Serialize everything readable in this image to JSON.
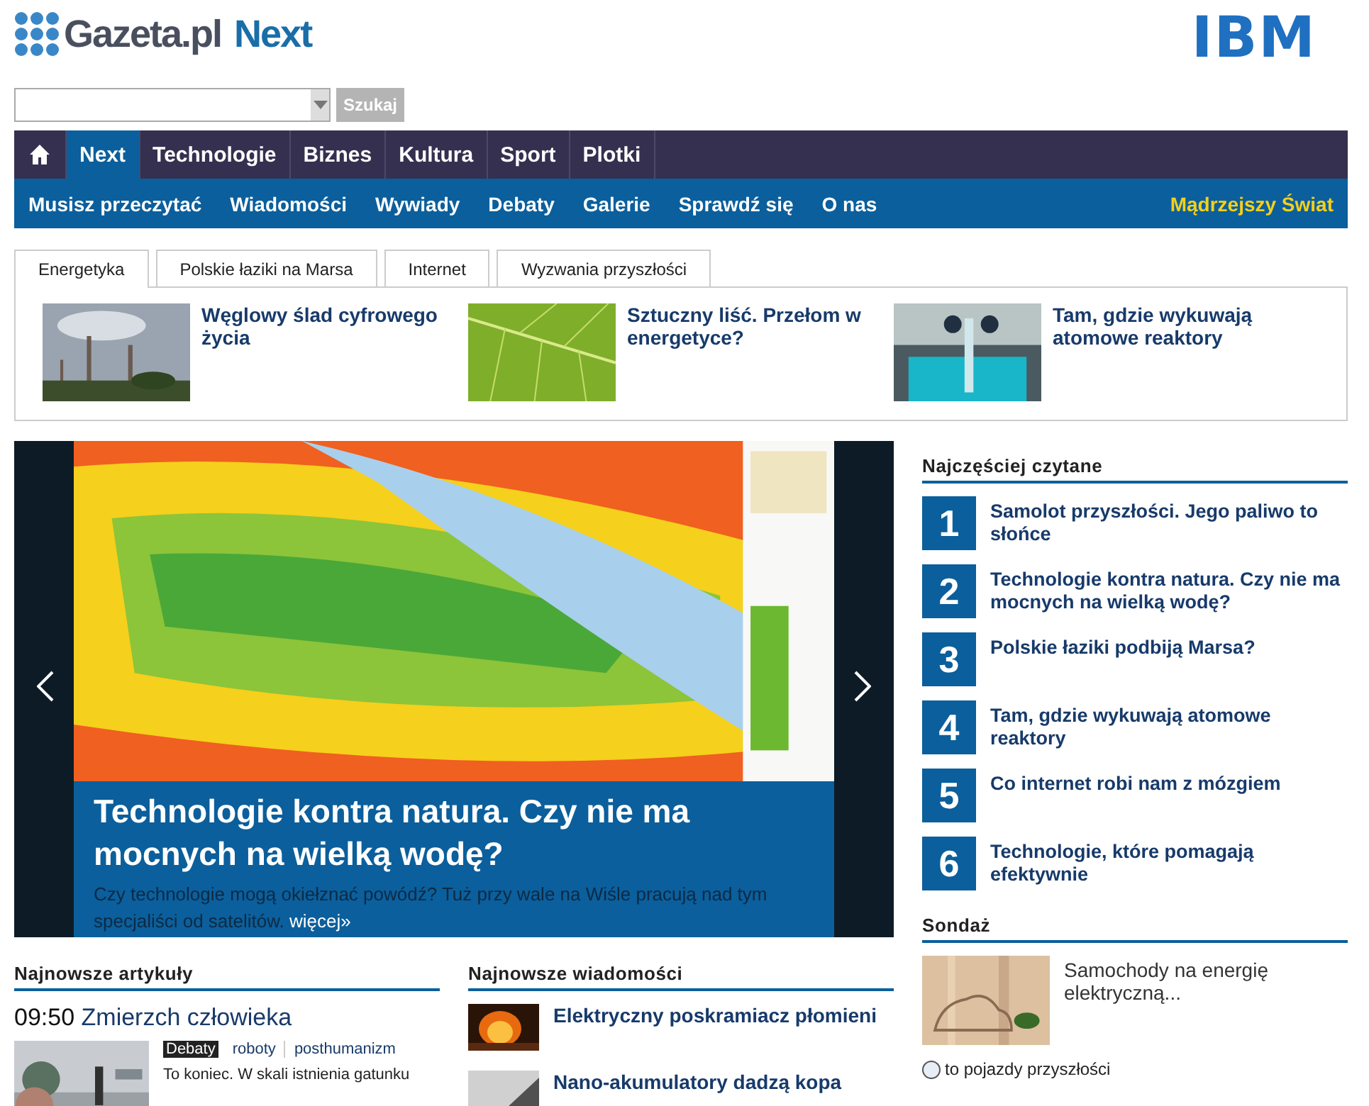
{
  "logo": {
    "brand": "Gazeta.pl",
    "product": "Next"
  },
  "sponsor": {
    "logo": "IBM"
  },
  "search": {
    "button": "Szukaj"
  },
  "main_nav": [
    {
      "label": "Next",
      "selected": true
    },
    {
      "label": "Technologie",
      "selected": false
    },
    {
      "label": "Biznes",
      "selected": false
    },
    {
      "label": "Kultura",
      "selected": false
    },
    {
      "label": "Sport",
      "selected": false
    },
    {
      "label": "Plotki",
      "selected": false
    }
  ],
  "sub_nav": {
    "items": [
      "Musisz przeczytać",
      "Wiadomości",
      "Wywiady",
      "Debaty",
      "Galerie",
      "Sprawdź się",
      "O nas"
    ],
    "featured": "Mądrzejszy Świat"
  },
  "topic_tabs": [
    {
      "label": "Energetyka",
      "selected": true
    },
    {
      "label": "Polskie łaziki na Marsa",
      "selected": false
    },
    {
      "label": "Internet",
      "selected": false
    },
    {
      "label": "Wyzwania przyszłości",
      "selected": false
    }
  ],
  "topic_articles": [
    {
      "title": "Węglowy ślad cyfrowego życia"
    },
    {
      "title": "Sztuczny liść. Przełom w energetyce?"
    },
    {
      "title": "Tam, gdzie wykuwają atomowe reaktory"
    }
  ],
  "slider": {
    "title": "Technologie kontra natura. Czy nie ma mocnych na wielką wodę?",
    "summary": "Czy technologie mogą okiełznać powódź? Tuż przy wale na Wiśle pracują nad tym specjaliści od satelitów.",
    "more": "więcej»"
  },
  "most_read": {
    "heading": "Najczęściej czytane",
    "items": [
      {
        "rank": "1",
        "title": "Samolot przyszłości. Jego paliwo to słońce"
      },
      {
        "rank": "2",
        "title": "Technologie kontra natura. Czy nie ma mocnych na wielką wodę?"
      },
      {
        "rank": "3",
        "title": "Polskie łaziki podbiją Marsa?"
      },
      {
        "rank": "4",
        "title": "Tam, gdzie wykuwają atomowe reaktory"
      },
      {
        "rank": "5",
        "title": "Co internet robi nam z mózgiem"
      },
      {
        "rank": "6",
        "title": "Technologie, które pomagają efektywnie"
      }
    ]
  },
  "poll": {
    "heading": "Sondaż",
    "question": "Samochody na energię elektryczną...",
    "options": [
      {
        "label": "to pojazdy przyszłości",
        "selected": false
      }
    ]
  },
  "latest_articles": {
    "heading": "Najnowsze artykuły",
    "items": [
      {
        "time": "09:50",
        "title": "Zmierzch człowieka",
        "tags": [
          {
            "label": "Debaty",
            "highlighted": true
          },
          {
            "label": "roboty",
            "highlighted": false
          },
          {
            "label": "posthumanizm",
            "highlighted": false
          }
        ],
        "excerpt": "To koniec. W skali istnienia gatunku"
      }
    ]
  },
  "latest_news": {
    "heading": "Najnowsze wiadomości",
    "items": [
      {
        "title": "Elektryczny poskramiacz płomieni"
      },
      {
        "title": "Nano-akumulatory dadzą kopa"
      }
    ]
  }
}
